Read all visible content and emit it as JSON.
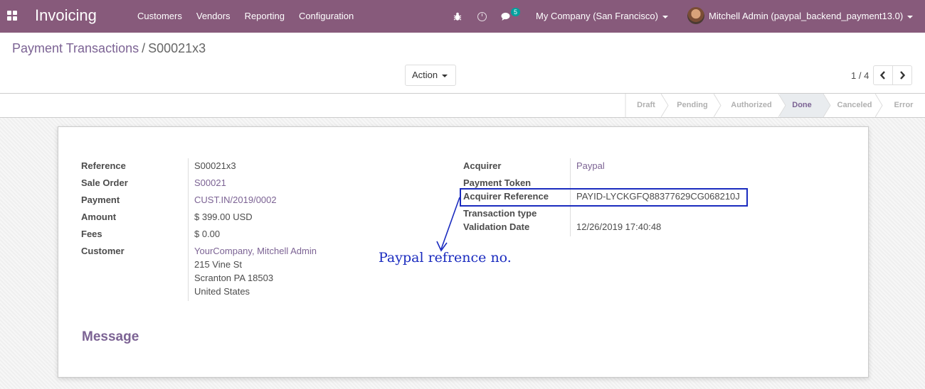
{
  "navbar": {
    "app_name": "Invoicing",
    "menu": [
      "Customers",
      "Vendors",
      "Reporting",
      "Configuration"
    ],
    "chat_count": "5",
    "company": "My Company (San Francisco)",
    "user": "Mitchell Admin (paypal_backend_payment13.0)"
  },
  "breadcrumb": {
    "parent": "Payment Transactions",
    "separator": "/",
    "current": "S00021x3"
  },
  "control": {
    "action_label": "Action",
    "pager": "1 / 4"
  },
  "statusbar": {
    "stages": [
      "Draft",
      "Pending",
      "Authorized",
      "Done",
      "Canceled",
      "Error"
    ],
    "active": "Done"
  },
  "form": {
    "left": {
      "reference_label": "Reference",
      "reference_value": "S00021x3",
      "sale_order_label": "Sale Order",
      "sale_order_value": "S00021",
      "payment_label": "Payment",
      "payment_value": "CUST.IN/2019/0002",
      "amount_label": "Amount",
      "amount_value": "$ 399.00",
      "amount_currency": "USD",
      "fees_label": "Fees",
      "fees_value": "$ 0.00",
      "customer_label": "Customer",
      "customer_name": "YourCompany, Mitchell Admin",
      "customer_street": "215 Vine St",
      "customer_city": "Scranton PA 18503",
      "customer_country": "United States"
    },
    "right": {
      "acquirer_label": "Acquirer",
      "acquirer_value": "Paypal",
      "payment_token_label": "Payment Token",
      "acquirer_reference_label": "Acquirer Reference",
      "acquirer_reference_value": "PAYID-LYCKGFQ88377629CG068210J",
      "transaction_type_label": "Transaction type",
      "validation_date_label": "Validation Date",
      "validation_date_value": "12/26/2019 17:40:48"
    },
    "message_title": "Message"
  },
  "annotation": {
    "text": "Paypal  refrence  no.",
    "color": "#1a2bbf"
  },
  "colors": {
    "navbar": "#875a7b",
    "link": "#7c6394",
    "badge": "#00a09d"
  }
}
